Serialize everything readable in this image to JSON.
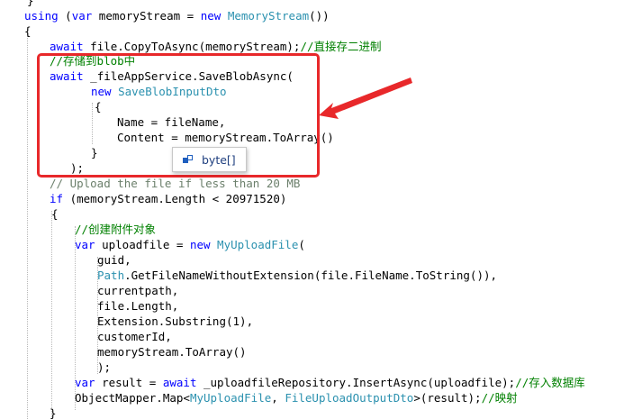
{
  "colors": {
    "keyword": "#0000ff",
    "type": "#2b91af",
    "comment": "#008000",
    "plain": "#000000",
    "highlight_box": "#e8282a",
    "tooltip_text": "#1f3f7f"
  },
  "lines": [
    {
      "segments": [
        {
          "t": "}",
          "c": "pl"
        }
      ]
    },
    {
      "segments": [
        {
          "t": "using",
          "c": "kw"
        },
        {
          "t": " (",
          "c": "pl"
        },
        {
          "t": "var",
          "c": "kw"
        },
        {
          "t": " memoryStream = ",
          "c": "pl"
        },
        {
          "t": "new",
          "c": "kw"
        },
        {
          "t": " ",
          "c": "pl"
        },
        {
          "t": "MemoryStream",
          "c": "ty"
        },
        {
          "t": "())",
          "c": "pl"
        }
      ]
    },
    {
      "segments": [
        {
          "t": "{",
          "c": "pl"
        }
      ]
    },
    {
      "segments": [
        {
          "t": "await",
          "c": "kw"
        },
        {
          "t": " file.CopyToAsync(memoryStream);",
          "c": "pl"
        },
        {
          "t": "//直接存二进制",
          "c": "cm"
        }
      ]
    },
    {
      "segments": [
        {
          "t": "//存储到blob中",
          "c": "cm"
        }
      ]
    },
    {
      "segments": [
        {
          "t": "await",
          "c": "kw"
        },
        {
          "t": " _fileAppService.SaveBlobAsync(",
          "c": "pl"
        }
      ]
    },
    {
      "segments": [
        {
          "t": "new",
          "c": "kw"
        },
        {
          "t": " ",
          "c": "pl"
        },
        {
          "t": "SaveBlobInputDto",
          "c": "ty"
        }
      ]
    },
    {
      "segments": [
        {
          "t": "{",
          "c": "pl"
        }
      ]
    },
    {
      "segments": [
        {
          "t": "Name = fileName,",
          "c": "pl"
        }
      ]
    },
    {
      "segments": [
        {
          "t": "Content = memoryStream.ToArray()",
          "c": "pl"
        }
      ]
    },
    {
      "segments": [
        {
          "t": "}",
          "c": "pl"
        }
      ]
    },
    {
      "segments": [
        {
          "t": ");",
          "c": "pl"
        }
      ]
    },
    {
      "segments": [
        {
          "t": "// Upload the file if less than 20 MB",
          "c": "cm-faded"
        }
      ]
    },
    {
      "segments": [
        {
          "t": "if",
          "c": "kw"
        },
        {
          "t": " (memoryStream.Length < 20971520)",
          "c": "pl"
        }
      ]
    },
    {
      "segments": [
        {
          "t": "{",
          "c": "pl"
        }
      ]
    },
    {
      "segments": [
        {
          "t": "//创建附件对象",
          "c": "cm"
        }
      ]
    },
    {
      "segments": [
        {
          "t": "var",
          "c": "kw"
        },
        {
          "t": " uploadfile = ",
          "c": "pl"
        },
        {
          "t": "new",
          "c": "kw"
        },
        {
          "t": " ",
          "c": "pl"
        },
        {
          "t": "MyUploadFile",
          "c": "ty"
        },
        {
          "t": "(",
          "c": "pl"
        }
      ]
    },
    {
      "segments": [
        {
          "t": "guid,",
          "c": "pl"
        }
      ]
    },
    {
      "segments": [
        {
          "t": "Path",
          "c": "ty"
        },
        {
          "t": ".GetFileNameWithoutExtension(file.FileName.ToString()),",
          "c": "pl"
        }
      ]
    },
    {
      "segments": [
        {
          "t": "currentpath,",
          "c": "pl"
        }
      ]
    },
    {
      "segments": [
        {
          "t": "file.Length,",
          "c": "pl"
        }
      ]
    },
    {
      "segments": [
        {
          "t": "Extension.Substring(1),",
          "c": "pl"
        }
      ]
    },
    {
      "segments": [
        {
          "t": "customerId,",
          "c": "pl"
        }
      ]
    },
    {
      "segments": [
        {
          "t": "memoryStream.ToArray()",
          "c": "pl"
        }
      ]
    },
    {
      "segments": [
        {
          "t": ");",
          "c": "pl"
        }
      ]
    },
    {
      "segments": [
        {
          "t": "var",
          "c": "kw"
        },
        {
          "t": " result = ",
          "c": "pl"
        },
        {
          "t": "await",
          "c": "kw"
        },
        {
          "t": " _uploadfileRepository.InsertAsync(uploadfile);",
          "c": "pl"
        },
        {
          "t": "//存入数据库",
          "c": "cm"
        }
      ]
    },
    {
      "segments": [
        {
          "t": "ObjectMapper.Map<",
          "c": "pl"
        },
        {
          "t": "MyUploadFile",
          "c": "ty"
        },
        {
          "t": ", ",
          "c": "pl"
        },
        {
          "t": "FileUploadOutputDto",
          "c": "ty"
        },
        {
          "t": ">(result);",
          "c": "pl"
        },
        {
          "t": "//映射",
          "c": "cm"
        }
      ]
    },
    {
      "segments": [
        {
          "t": "}",
          "c": "pl"
        }
      ]
    }
  ],
  "tooltip": {
    "icon": "struct-icon",
    "label": "byte[]"
  }
}
